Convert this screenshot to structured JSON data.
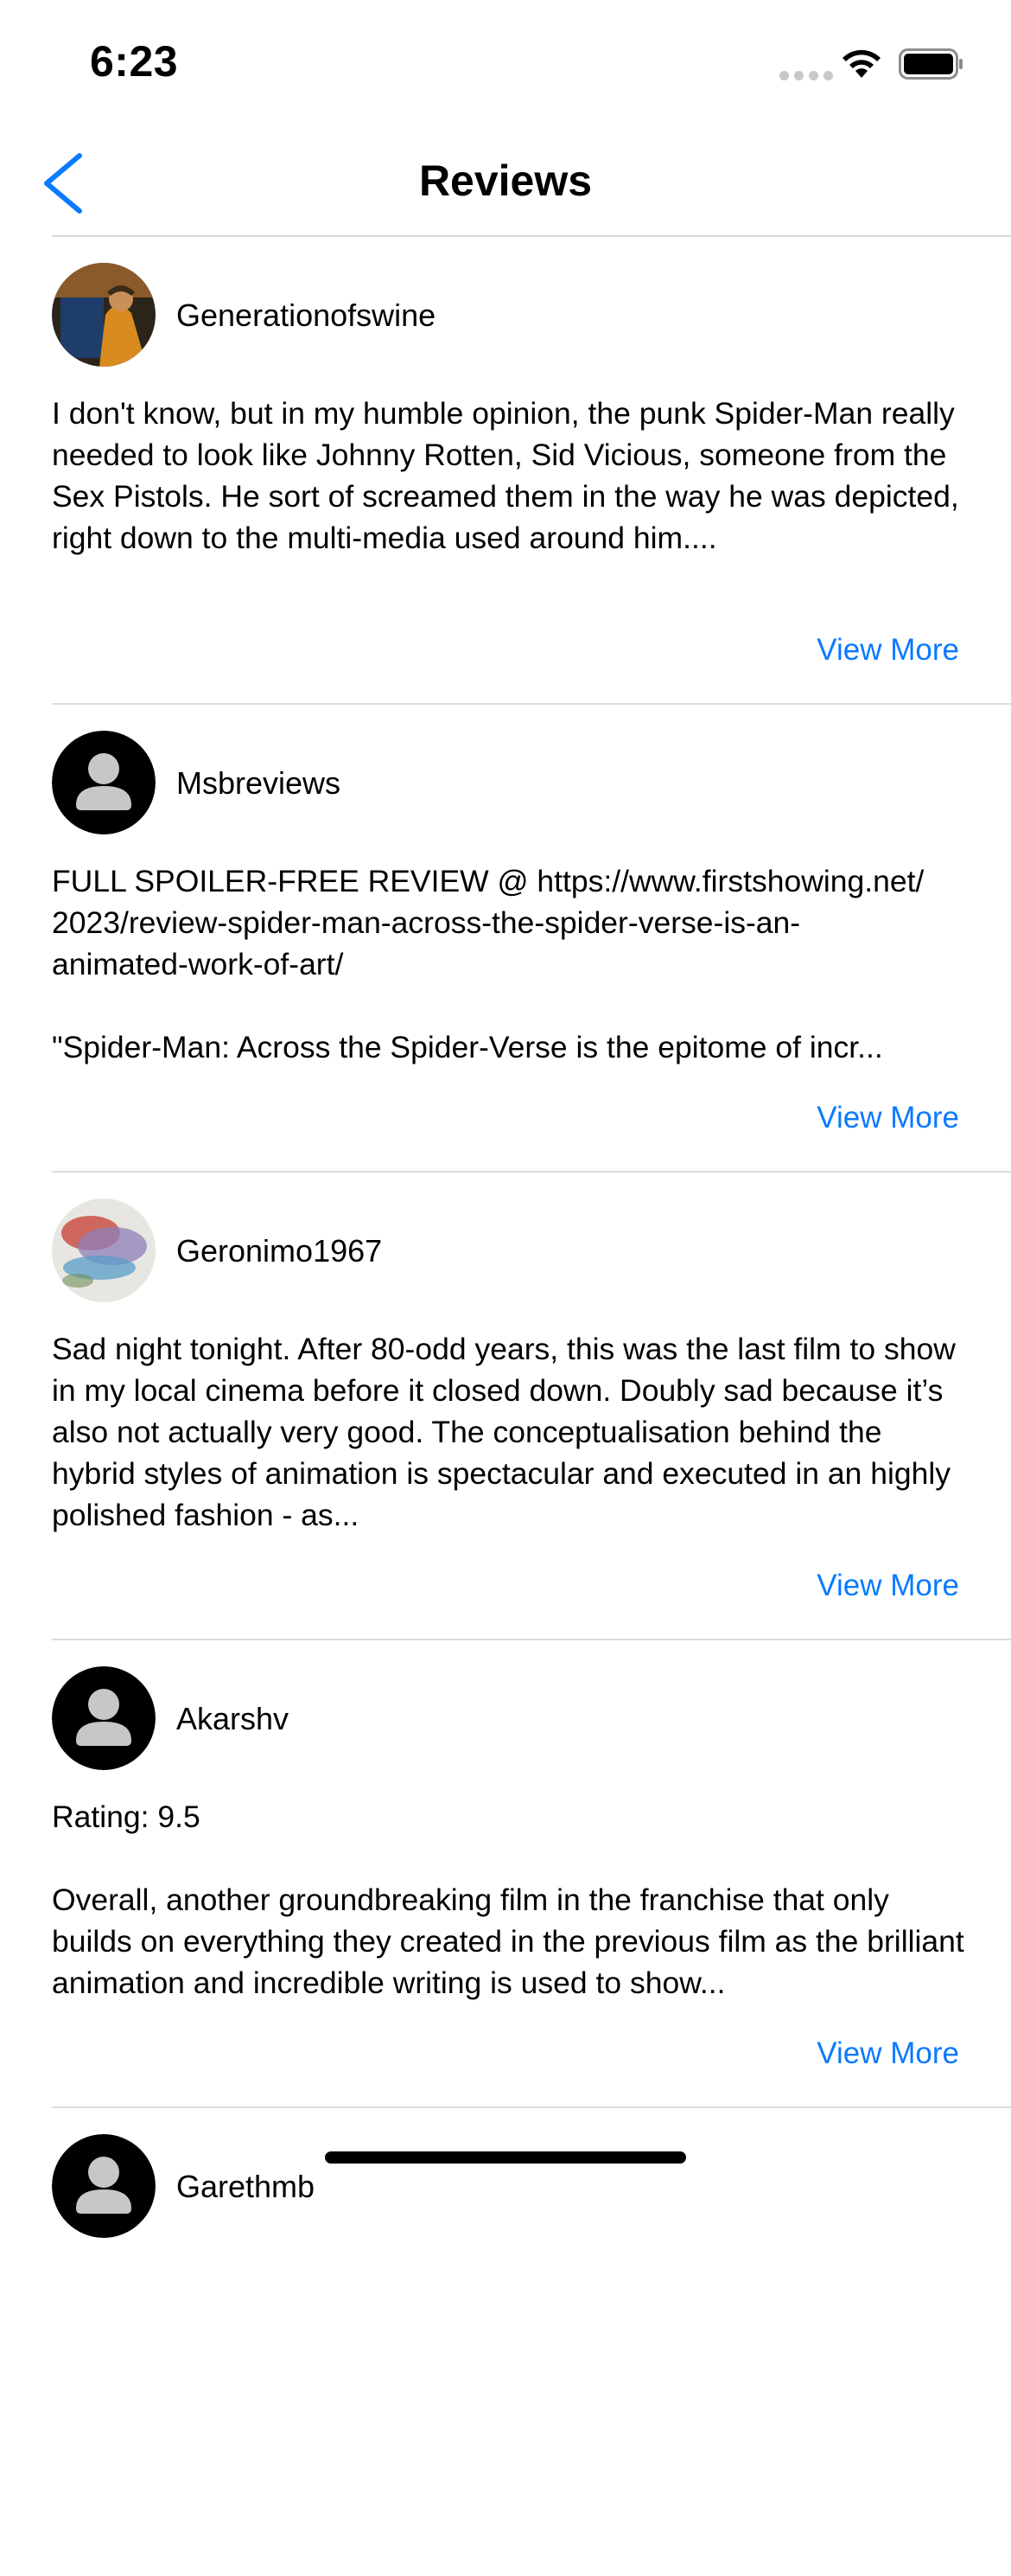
{
  "status_bar": {
    "time": "6:23"
  },
  "nav": {
    "title": "Reviews"
  },
  "reviews": [
    {
      "author": "Generationofswine",
      "avatar": "photo",
      "text": "I don't know, but in my humble opinion, the punk Spider-Man really needed to look like Johnny Rotten, Sid Vicious, someone from the Sex Pistols.  He sort of screamed them in the way he was depicted, right down to the multi-media used around him....",
      "more_label": "View More"
    },
    {
      "author": "Msbreviews",
      "avatar": "default",
      "text": "FULL SPOILER-FREE REVIEW @ https://www.firstshowing.net/\n2023/review-spider-man-across-the-spider-verse-is-an-\nanimated-work-of-art/\n\n\"Spider-Man: Across the Spider-Verse is the epitome of incr...",
      "more_label": "View More"
    },
    {
      "author": "Geronimo1967",
      "avatar": "photo",
      "text": "Sad night tonight. After 80-odd years, this was the last film to show in my local cinema before it closed down. Doubly sad because it’s also not actually very good. The conceptualisation behind the hybrid styles of animation is spectacular and executed in an highly polished fashion - as...",
      "more_label": "View More"
    },
    {
      "author": "Akarshv",
      "avatar": "default",
      "text": "Rating: 9.5\n\nOverall, another groundbreaking film in the franchise that only builds on everything they created in the previous film as the brilliant animation and incredible writing is used to show...",
      "more_label": "View More"
    },
    {
      "author": "Garethmb",
      "avatar": "default",
      "text": "",
      "more_label": ""
    }
  ],
  "colors": {
    "accent": "#0a7aff",
    "divider": "#dcdcdc"
  }
}
